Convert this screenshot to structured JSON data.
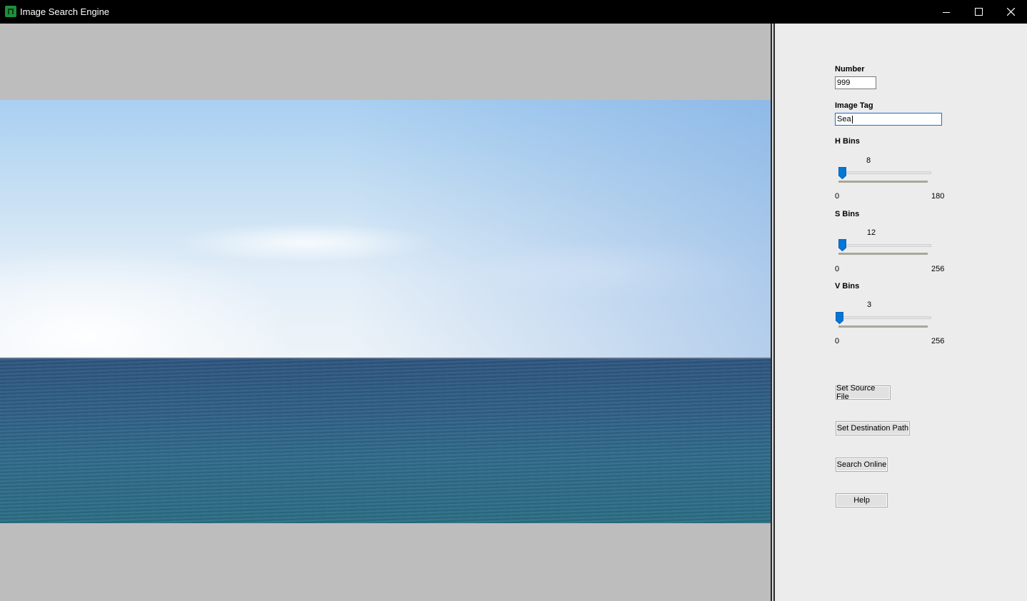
{
  "window": {
    "title": "Image Search Engine",
    "controls": {
      "minimize": "minimize-icon",
      "maximize": "maximize-icon",
      "close": "close-icon"
    }
  },
  "viewer": {
    "image_icon": "photo-sea-horizon"
  },
  "panel": {
    "number": {
      "label": "Number",
      "value": "999"
    },
    "image_tag": {
      "label": "Image Tag",
      "value": "Sea"
    },
    "h_bins": {
      "label": "H Bins",
      "value": 8,
      "value_text": "8",
      "min": "0",
      "max": "180"
    },
    "s_bins": {
      "label": "S Bins",
      "value": 12,
      "value_text": "12",
      "min": "0",
      "max": "256"
    },
    "v_bins": {
      "label": "V Bins",
      "value": 3,
      "value_text": "3",
      "min": "0",
      "max": "256"
    },
    "buttons": {
      "set_source": "Set Source File",
      "set_destination": "Set Destination Path",
      "search_online": "Search Online",
      "help": "Help"
    }
  },
  "colors": {
    "accent": "#0078d7",
    "panel_bg": "#ececec",
    "viewer_bg": "#bdbdbd",
    "titlebar_bg": "#000000"
  }
}
